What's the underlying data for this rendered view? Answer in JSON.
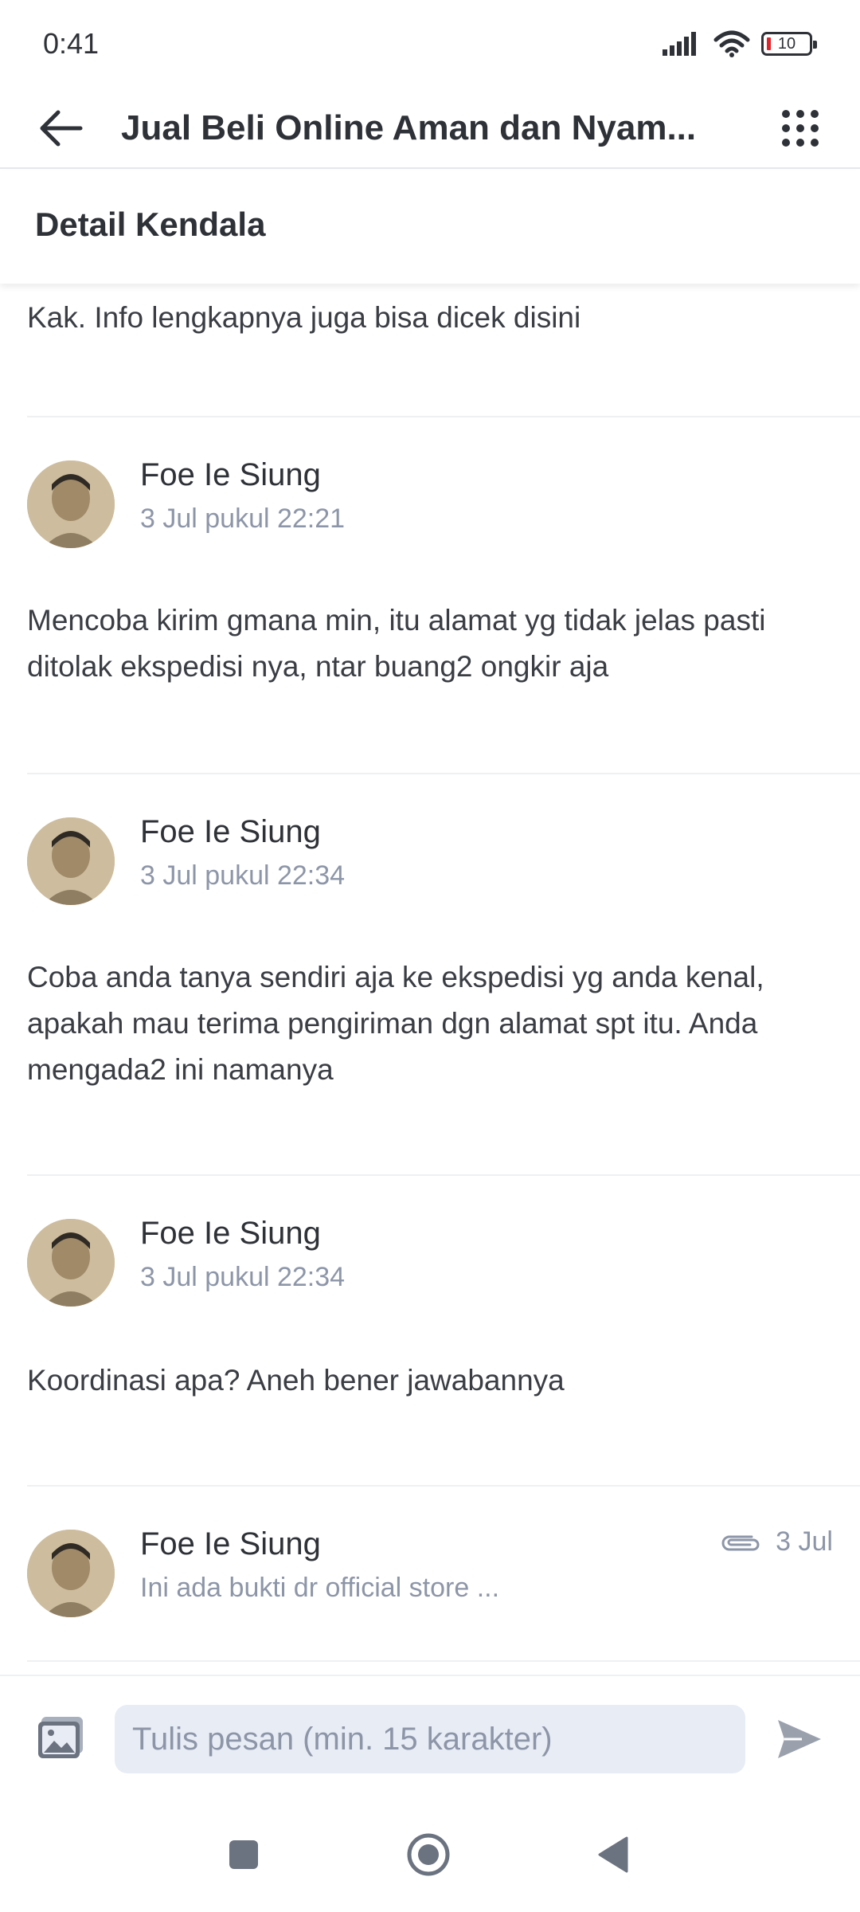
{
  "status_bar": {
    "time": "0:41",
    "battery": "10"
  },
  "app_bar": {
    "title": "Jual Beli Online Aman dan Nyam..."
  },
  "section": {
    "title": "Detail Kendala"
  },
  "partial_message": {
    "text": "Kak. Info lengkapnya juga bisa dicek disini"
  },
  "messages": [
    {
      "name": "Foe Ie Siung",
      "time": "3 Jul pukul 22:21",
      "text": "Mencoba kirim gmana min, itu alamat yg tidak jelas pasti ditolak ekspedisi nya, ntar buang2 ongkir aja"
    },
    {
      "name": "Foe Ie Siung",
      "time": "3 Jul pukul 22:34",
      "text": "Coba anda tanya sendiri aja ke ekspedisi yg anda kenal, apakah mau terima pengiriman dgn alamat spt itu. Anda mengada2 ini namanya"
    },
    {
      "name": "Foe Ie Siung",
      "time": "3 Jul pukul 22:34",
      "text": "Koordinasi apa? Aneh bener jawabannya"
    },
    {
      "name": "Foe Ie Siung",
      "preview": "Ini ada bukti dr official store ...",
      "date": "3 Jul"
    }
  ],
  "input": {
    "placeholder": "Tulis pesan (min. 15 karakter)"
  },
  "icons": {
    "back": "arrow-left-icon",
    "menu": "grid-dots-icon",
    "attachment": "paperclip-icon",
    "image": "image-icon",
    "send": "send-icon"
  },
  "colors": {
    "text": "#2e3137",
    "muted": "#8d96a8",
    "input_bg": "#e8ecf5",
    "divider": "#eef0f2"
  }
}
